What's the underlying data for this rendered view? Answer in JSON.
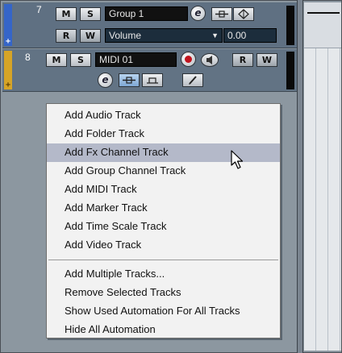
{
  "tracks": [
    {
      "number": "7",
      "mute_label": "M",
      "solo_label": "S",
      "name": "Group 1",
      "edit_label": "e",
      "read_label": "R",
      "write_label": "W",
      "automation_param": "Volume",
      "automation_value": "0.00",
      "color": "#3565c8",
      "plus": "+"
    },
    {
      "number": "8",
      "mute_label": "M",
      "solo_label": "S",
      "name": "MIDI 01",
      "edit_label": "e",
      "read_label": "R",
      "write_label": "W",
      "color": "#d6a427",
      "plus": "+"
    }
  ],
  "context_menu": {
    "group1": [
      "Add Audio Track",
      "Add Folder Track",
      "Add Fx Channel Track",
      "Add Group Channel Track",
      "Add MIDI Track",
      "Add Marker Track",
      "Add Time Scale Track",
      "Add Video Track"
    ],
    "group2": [
      "Add Multiple Tracks...",
      "Remove Selected Tracks",
      "Show Used Automation For All Tracks",
      "Hide All Automation"
    ],
    "highlighted": "Add Fx Channel Track"
  }
}
